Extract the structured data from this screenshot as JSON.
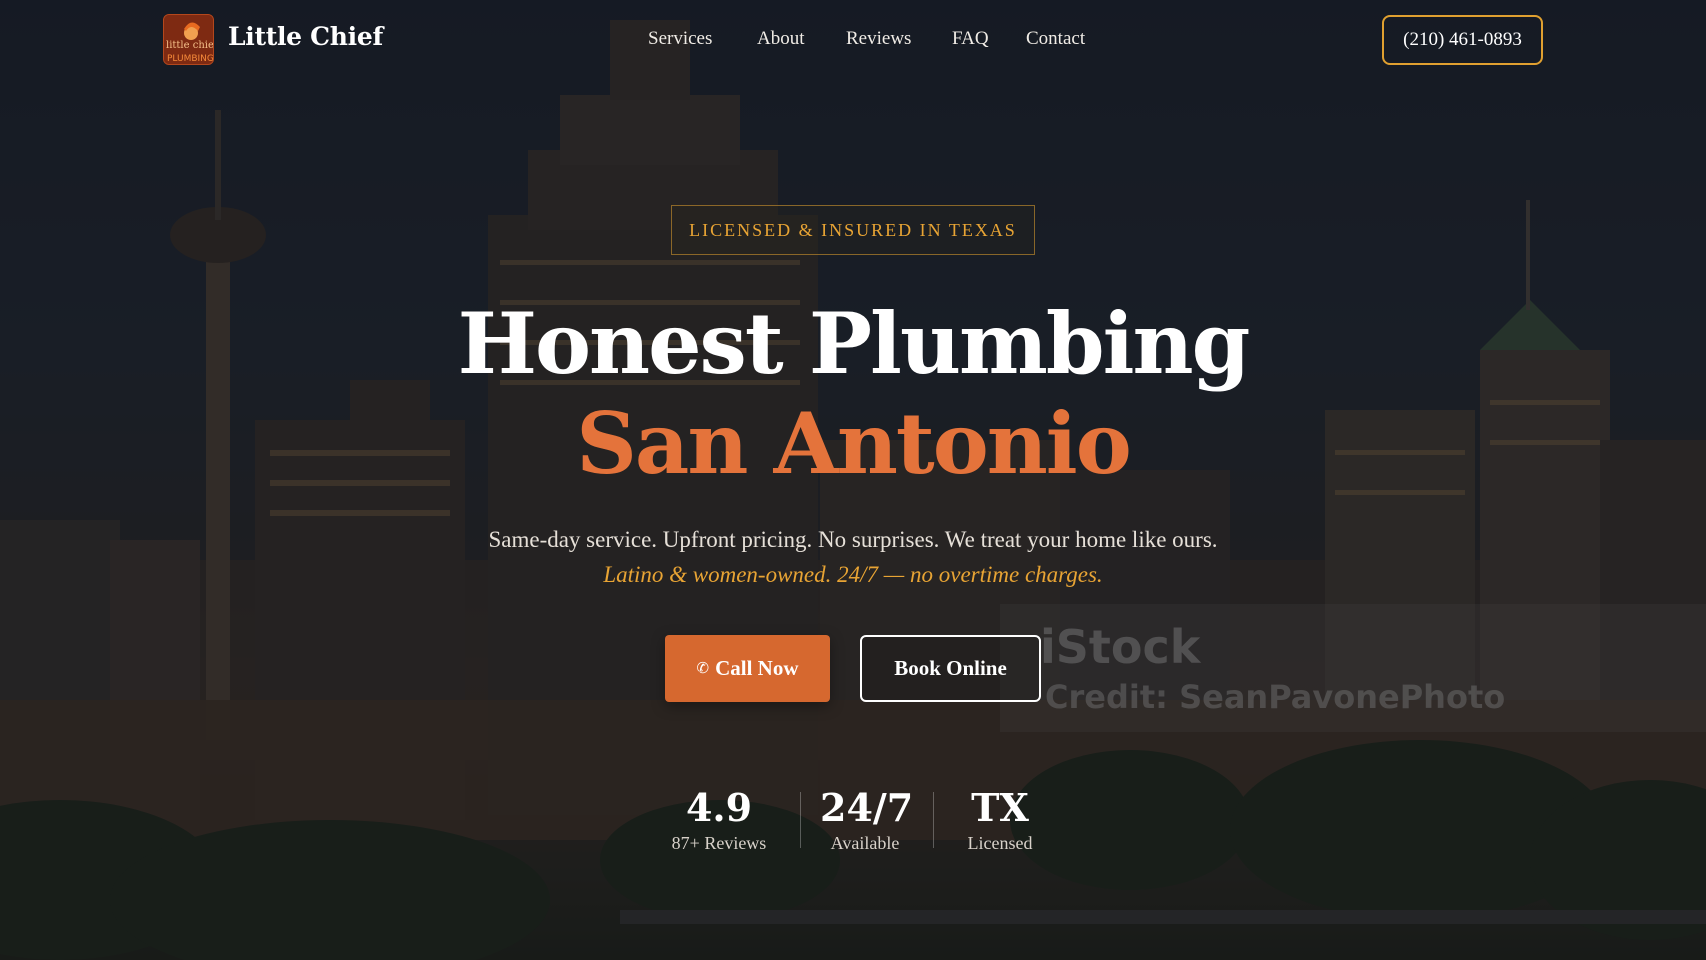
{
  "nav": {
    "brand": "Little Chief",
    "logo_text_1": "little chief",
    "logo_text_2": "PLUMBING",
    "links": [
      "Services",
      "About",
      "Reviews",
      "FAQ",
      "Contact"
    ],
    "phone": "(210) 461-0893"
  },
  "hero": {
    "badge": "LICENSED & INSURED IN TEXAS",
    "headline_line1": "Honest Plumbing",
    "headline_line2": "San Antonio",
    "sub_plain": "Same-day service. Upfront pricing. No surprises. We treat your home like ours.",
    "sub_emphasis": "Latino & women-owned. 24/7 — no overtime charges.",
    "cta_call": "Call Now",
    "cta_call_icon": "phone-icon",
    "cta_book": "Book Online"
  },
  "stats": [
    {
      "value": "4.9",
      "label": "87+ Reviews"
    },
    {
      "value": "24/7",
      "label": "Available"
    },
    {
      "value": "TX",
      "label": "Licensed"
    }
  ],
  "watermark": {
    "brand": "iStock",
    "credit": "Credit: SeanPavonePhoto"
  },
  "colors": {
    "accent_orange": "#d6682f",
    "headline_orange": "#e4733b",
    "gold": "#e8a434"
  }
}
